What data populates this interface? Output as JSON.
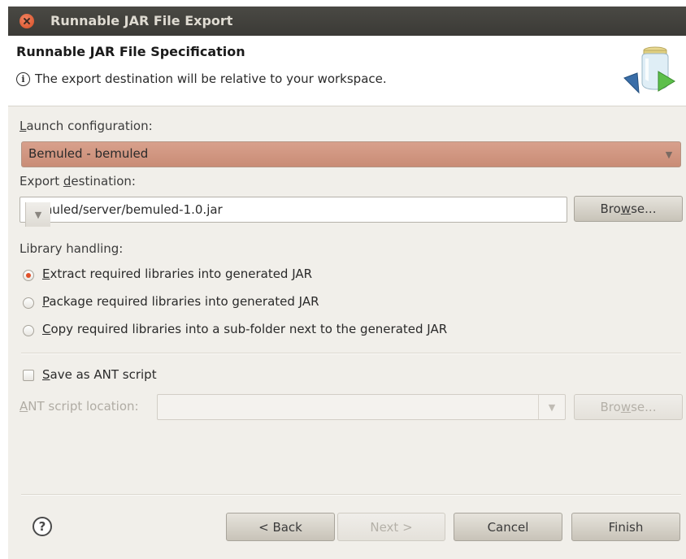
{
  "window": {
    "title": "Runnable JAR File Export"
  },
  "header": {
    "title": "Runnable JAR File Specification",
    "message": "The export destination will be relative to your workspace."
  },
  "launch": {
    "label_prefix": "",
    "label_mnemonic": "L",
    "label_rest": "aunch configuration:",
    "value": "Bemuled - bemuled"
  },
  "export": {
    "label_prefix": "Export ",
    "label_mnemonic": "d",
    "label_rest": "estination:",
    "value": "bemuled/server/bemuled-1.0.jar",
    "browse_prefix": "Bro",
    "browse_mnemonic": "w",
    "browse_rest": "se..."
  },
  "library": {
    "label": "Library handling:",
    "options": [
      {
        "mnemonic": "E",
        "rest": "xtract required libraries into generated JAR",
        "checked": true
      },
      {
        "mnemonic": "P",
        "rest": "ackage required libraries into generated JAR",
        "checked": false
      },
      {
        "mnemonic": "C",
        "rest": "opy required libraries into a sub-folder next to the generated JAR",
        "checked": false
      }
    ]
  },
  "ant": {
    "checkbox_mnemonic": "S",
    "checkbox_rest": "ave as ANT script",
    "checked": false,
    "location_mnemonic": "A",
    "location_rest": "NT script location:",
    "location_value": "",
    "browse_prefix": "Bro",
    "browse_mnemonic": "w",
    "browse_rest": "se..."
  },
  "buttons": {
    "back": "< Back",
    "next": "Next >",
    "cancel": "Cancel",
    "finish": "Finish"
  },
  "colors": {
    "titlebar": "#3b3a36",
    "launch_combo": "#c98c76",
    "radio_selected": "#e0502a"
  }
}
